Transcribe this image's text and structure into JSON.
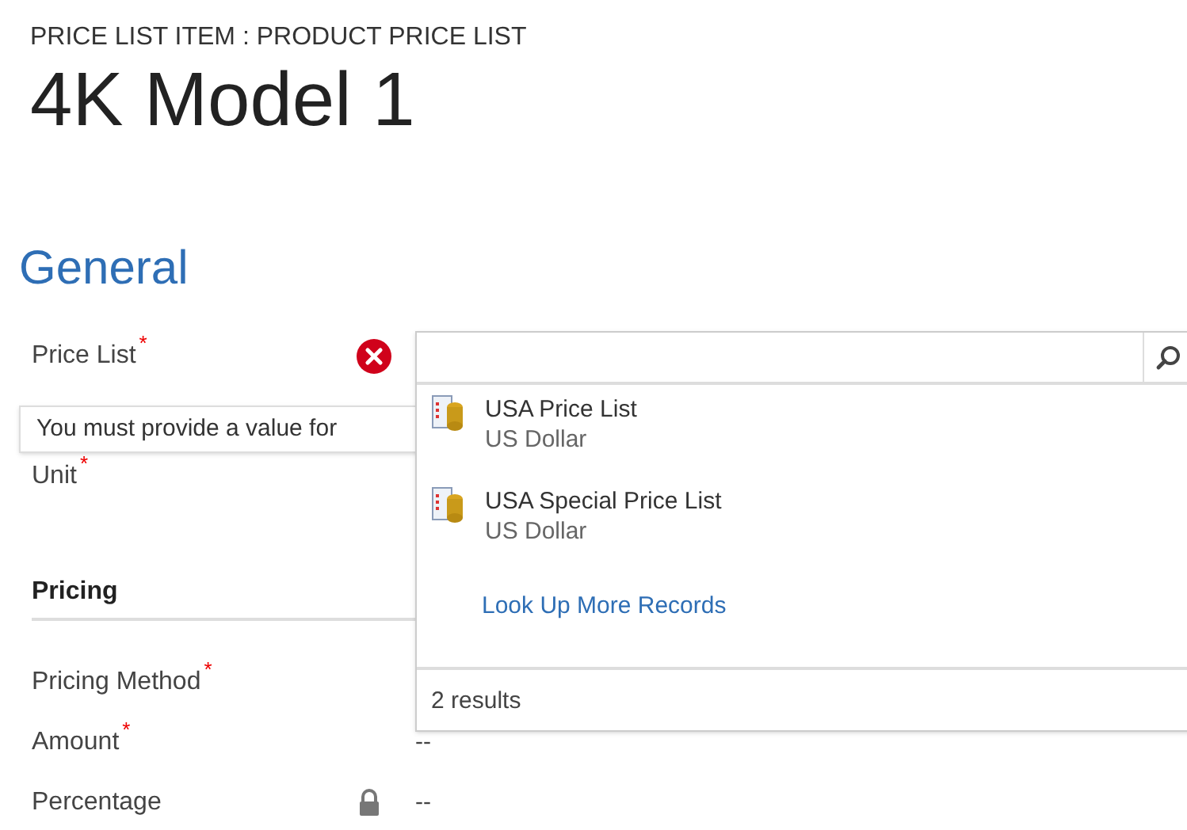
{
  "header": {
    "entity": "PRICE LIST ITEM : PRODUCT PRICE LIST",
    "title": "4K Model 1"
  },
  "section": {
    "title": "General"
  },
  "required_mark": "*",
  "general_fields": [
    {
      "label": "Price List",
      "required": true,
      "error": true
    },
    {
      "label": "Unit",
      "required": true,
      "error": false
    }
  ],
  "error_tooltip": "You must provide a value for",
  "pricing": {
    "title": "Pricing",
    "fields": [
      {
        "label": "Pricing Method",
        "required": true,
        "locked": false
      },
      {
        "label": "Amount",
        "required": true,
        "locked": false,
        "value": "--"
      },
      {
        "label": "Percentage",
        "required": false,
        "locked": true,
        "value": "--"
      }
    ]
  },
  "lookup": {
    "results": [
      {
        "name": "USA Price List",
        "currency": "US Dollar"
      },
      {
        "name": "USA Special Price List",
        "currency": "US Dollar"
      }
    ],
    "more_link": "Look Up More Records",
    "count": "2 results"
  }
}
